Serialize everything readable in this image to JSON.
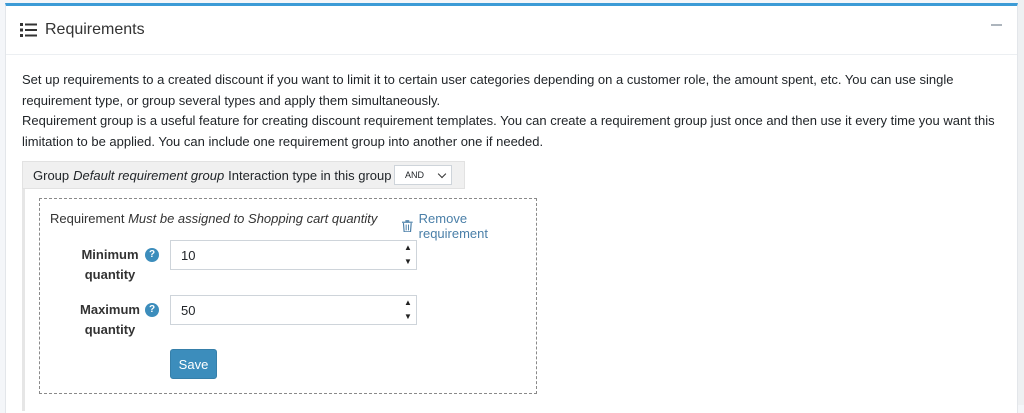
{
  "card": {
    "title": "Requirements",
    "title_icon": "list-icon",
    "collapse_icon": "minus-icon"
  },
  "description": {
    "paragraph1": "Set up requirements to a created discount if you want to limit it to certain user categories depending on a customer role, the amount spent, etc. You can use single requirement type, or group several types and apply them simultaneously.",
    "paragraph2": "Requirement group is a useful feature for creating discount requirement templates. You can create a requirement group just once and then use it every time you want this limitation to be applied. You can include one requirement group into another one if needed."
  },
  "group": {
    "prefix": "Group",
    "name": "Default requirement group",
    "interaction_label": "Interaction type in this group is",
    "interaction_value": "AND"
  },
  "requirement": {
    "prefix": "Requirement",
    "name": "Must be assigned to Shopping cart quantity",
    "remove_label": "Remove requirement",
    "remove_icon": "trash-icon",
    "fields": [
      {
        "label": "Minimum quantity",
        "value": "10",
        "help_icon": "question-icon"
      },
      {
        "label": "Maximum quantity",
        "value": "50",
        "help_icon": "question-icon"
      }
    ],
    "save_label": "Save"
  },
  "colors": {
    "accent": "#3c9bd6",
    "button": "#3c8dbc",
    "link": "#4a7fa8"
  }
}
